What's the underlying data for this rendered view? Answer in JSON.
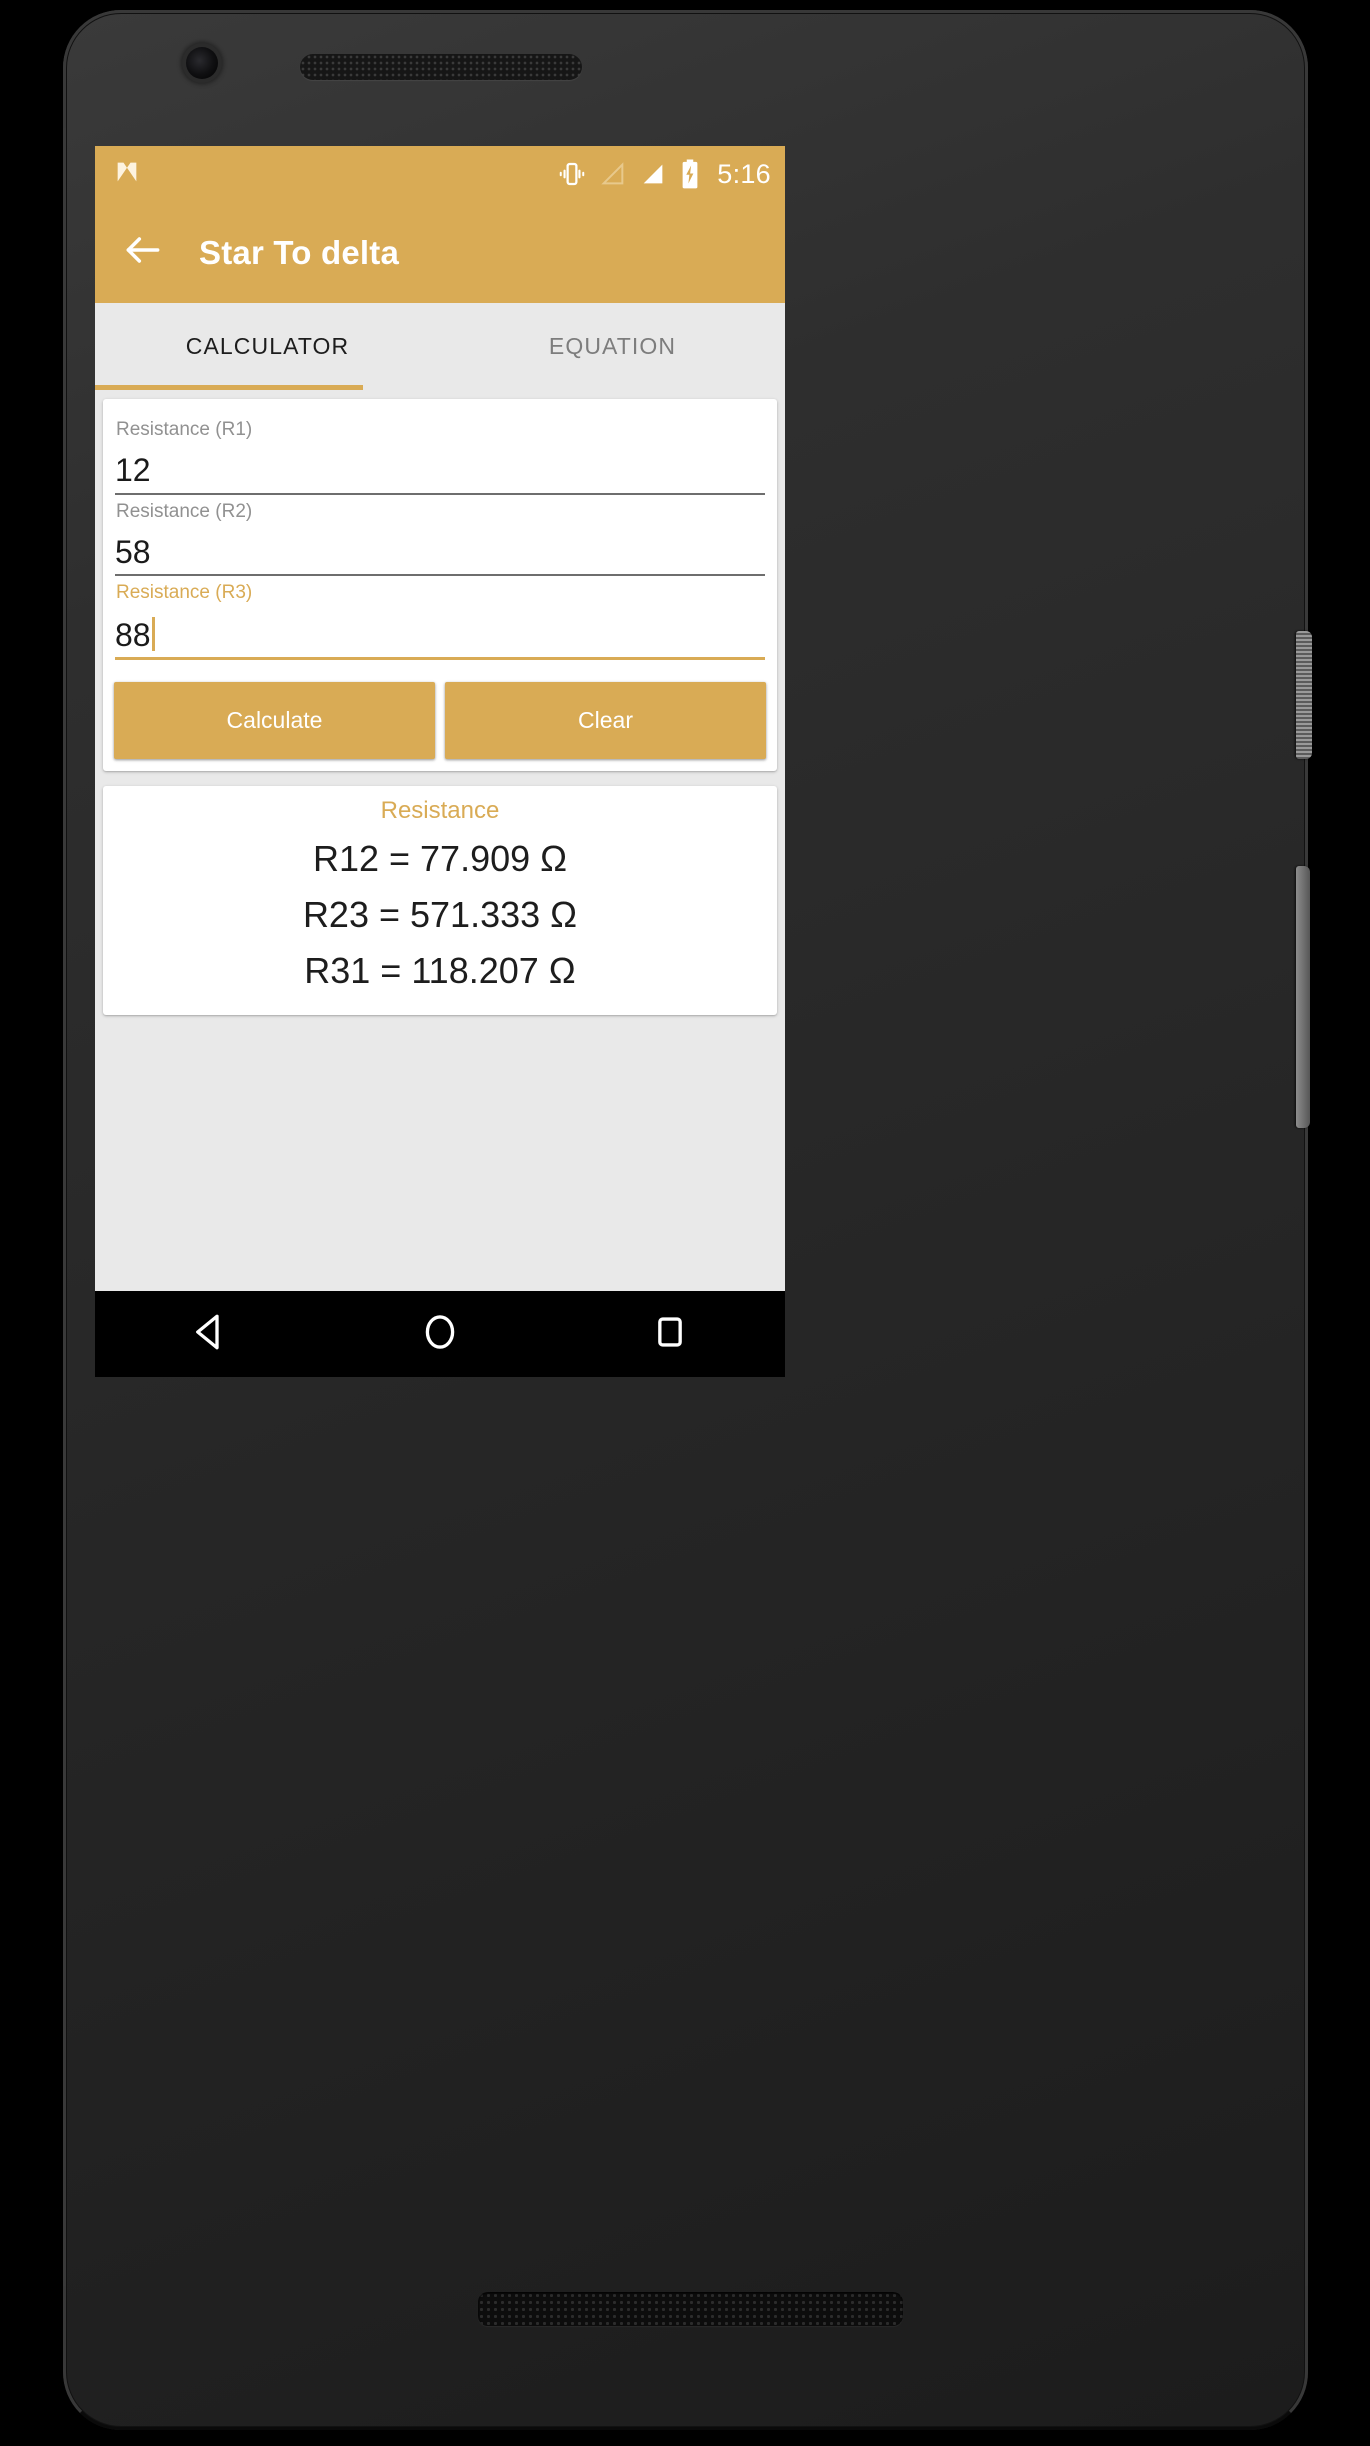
{
  "device": {
    "hardware": {
      "front_camera": "front-camera",
      "earpiece": "earpiece-speaker",
      "bottom_speaker": "bottom-speaker",
      "power_button": "power-button",
      "volume_button": "volume-button"
    }
  },
  "status_bar": {
    "background_color": "#d9ab55",
    "os_logo_icon": "android-nougat-logo",
    "icons": [
      {
        "name": "vibrate-icon",
        "state": "on"
      },
      {
        "name": "signal-cellular-1-icon",
        "state": "empty"
      },
      {
        "name": "signal-cellular-2-icon",
        "state": "full"
      },
      {
        "name": "battery-charging-icon",
        "state": "charging"
      }
    ],
    "clock": "5:16"
  },
  "app_bar": {
    "back_icon": "arrow-left-icon",
    "title": "Star To delta",
    "background_color": "#d9ab55",
    "text_color": "#ffffff"
  },
  "tabs": {
    "active_index": 0,
    "indicator_color": "#d9ab55",
    "items": [
      {
        "label": "CALCULATOR",
        "active": true
      },
      {
        "label": "EQUATION",
        "active": false
      }
    ]
  },
  "calculator": {
    "fields": [
      {
        "label": "Resistance (R1)",
        "value": "12",
        "focused": false
      },
      {
        "label": "Resistance (R2)",
        "value": "58",
        "focused": false
      },
      {
        "label": "Resistance (R3)",
        "value": "88",
        "focused": true
      }
    ],
    "buttons": [
      {
        "label": "Calculate",
        "name": "calculate-button"
      },
      {
        "label": "Clear",
        "name": "clear-button"
      }
    ]
  },
  "results": {
    "title": "Resistance",
    "title_color": "#d9ab55",
    "lines": [
      "R12 = 77.909 Ω",
      "R23 = 571.333 Ω",
      "R31 = 118.207 Ω"
    ]
  },
  "navigation_bar": {
    "background_color": "#000000",
    "buttons": [
      {
        "name": "nav-back-button",
        "icon": "triangle-left-icon"
      },
      {
        "name": "nav-home-button",
        "icon": "circle-icon"
      },
      {
        "name": "nav-recents-button",
        "icon": "square-icon"
      }
    ]
  }
}
